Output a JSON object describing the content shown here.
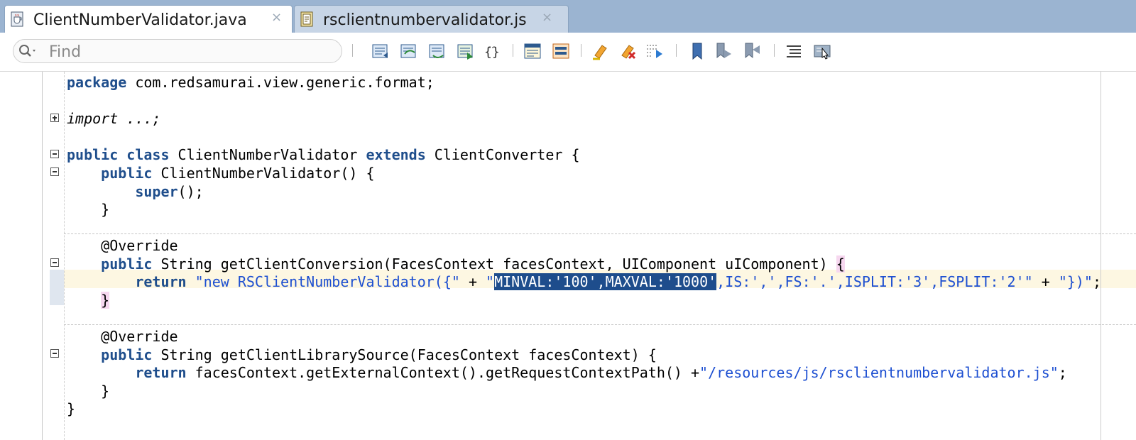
{
  "tabs": [
    {
      "label": "ClientNumberValidator.java",
      "icon": "java-file-icon",
      "active": true
    },
    {
      "label": "rsclientnumbervalidator.js",
      "icon": "js-file-icon",
      "active": false
    }
  ],
  "close_glyph": "×",
  "search": {
    "placeholder": "Find",
    "value": ""
  },
  "toolbar_icons": [
    "find-previous-icon",
    "find-next-icon",
    "find-selected-icon",
    "replace-icon",
    "match-braces-icon",
    "toggle-comment-icon",
    "uncomment-icon",
    "highlight-icon",
    "clear-highlight-icon",
    "goto-icon",
    "bookmark-icon",
    "next-bookmark-icon",
    "previous-bookmark-icon",
    "format-icon",
    "toggle-view-icon"
  ],
  "code": {
    "line1_kw": "package",
    "line1_rest": " com.redsamurai.view.generic.format;",
    "line2_kw": "import",
    "line2_rest": " ...;",
    "line3_kw1": "public",
    "line3_kw2": "class",
    "line3_mid": " ClientNumberValidator ",
    "line3_kw3": "extends",
    "line3_rest": " ClientConverter {",
    "line4_kw": "public",
    "line4_rest": " ClientNumberValidator() {",
    "line5_kw": "super",
    "line5_rest": "();",
    "line6": "}",
    "line7": "@Override",
    "line8_kw": "public",
    "line8_rest": " String getClientConversion(FacesContext facesContext, UIComponent uIComponent) ",
    "line8_brace": "{",
    "line9_kw": "return",
    "line9_str1": "\"new RSClientNumberValidator({\"",
    "line9_plus1": " + ",
    "line9_q": "\"",
    "line9_sel": "MINVAL:'100',MAXVAL:'1000'",
    "line9_str2": ",IS:',',FS:'.',ISPLIT:'3',FSPLIT:'2'\"",
    "line9_plus2": " + ",
    "line9_str3": "\"})\"",
    "line9_end": ";",
    "line10": "}",
    "line11": "@Override",
    "line12_kw": "public",
    "line12_rest": " String getClientLibrarySource(FacesContext facesContext) {",
    "line13_kw": "return",
    "line13_rest": " facesContext.getExternalContext().getRequestContextPath() +",
    "line13_str": "\"/resources/js/rsclientnumbervalidator.js\"",
    "line13_end": ";",
    "line14": "}",
    "line15": "}"
  }
}
